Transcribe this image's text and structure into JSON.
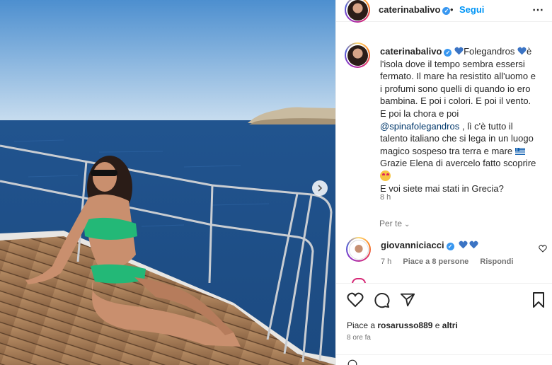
{
  "post": {
    "username": "caterinabalivo",
    "follow_label": "Segui",
    "dot": "•",
    "more_icon": "more-horizontal-icon"
  },
  "caption": {
    "username": "caterinabalivo",
    "part1": "Folegandros",
    "part2": "è l'isola dove il tempo sembra essersi fermato. Il mare ha resistito all'uomo e i profumi sono quelli di quando io ero bambina. E poi i colori. E poi il vento. E poi la chora e poi",
    "mention": "@spinafolegandros",
    "part3": ", lì c'è tutto il talento italiano che si lega in un luogo magico sospeso tra terra e mare",
    "line_thanks": "Grazie Elena di avercelo fatto scoprire",
    "line_question": "E voi siete mai stati in Grecia?",
    "time": "8 h",
    "translate_label": "Per te",
    "colors": {
      "heart_blue": "#3b74c4"
    }
  },
  "comment": {
    "username": "giovanniciacci",
    "time": "7 h",
    "likes_label": "Piace a 8 persone",
    "reply_label": "Rispondi"
  },
  "actions": {
    "liked_by_prefix": "Piace a",
    "liked_by_user": "rosarusso889",
    "liked_by_join": "e",
    "liked_by_suffix": "altri",
    "time": "8 ore fa"
  },
  "colors": {
    "link_blue": "#0095f6",
    "mention_blue": "#00376b",
    "muted": "#737373",
    "text": "#262626"
  }
}
